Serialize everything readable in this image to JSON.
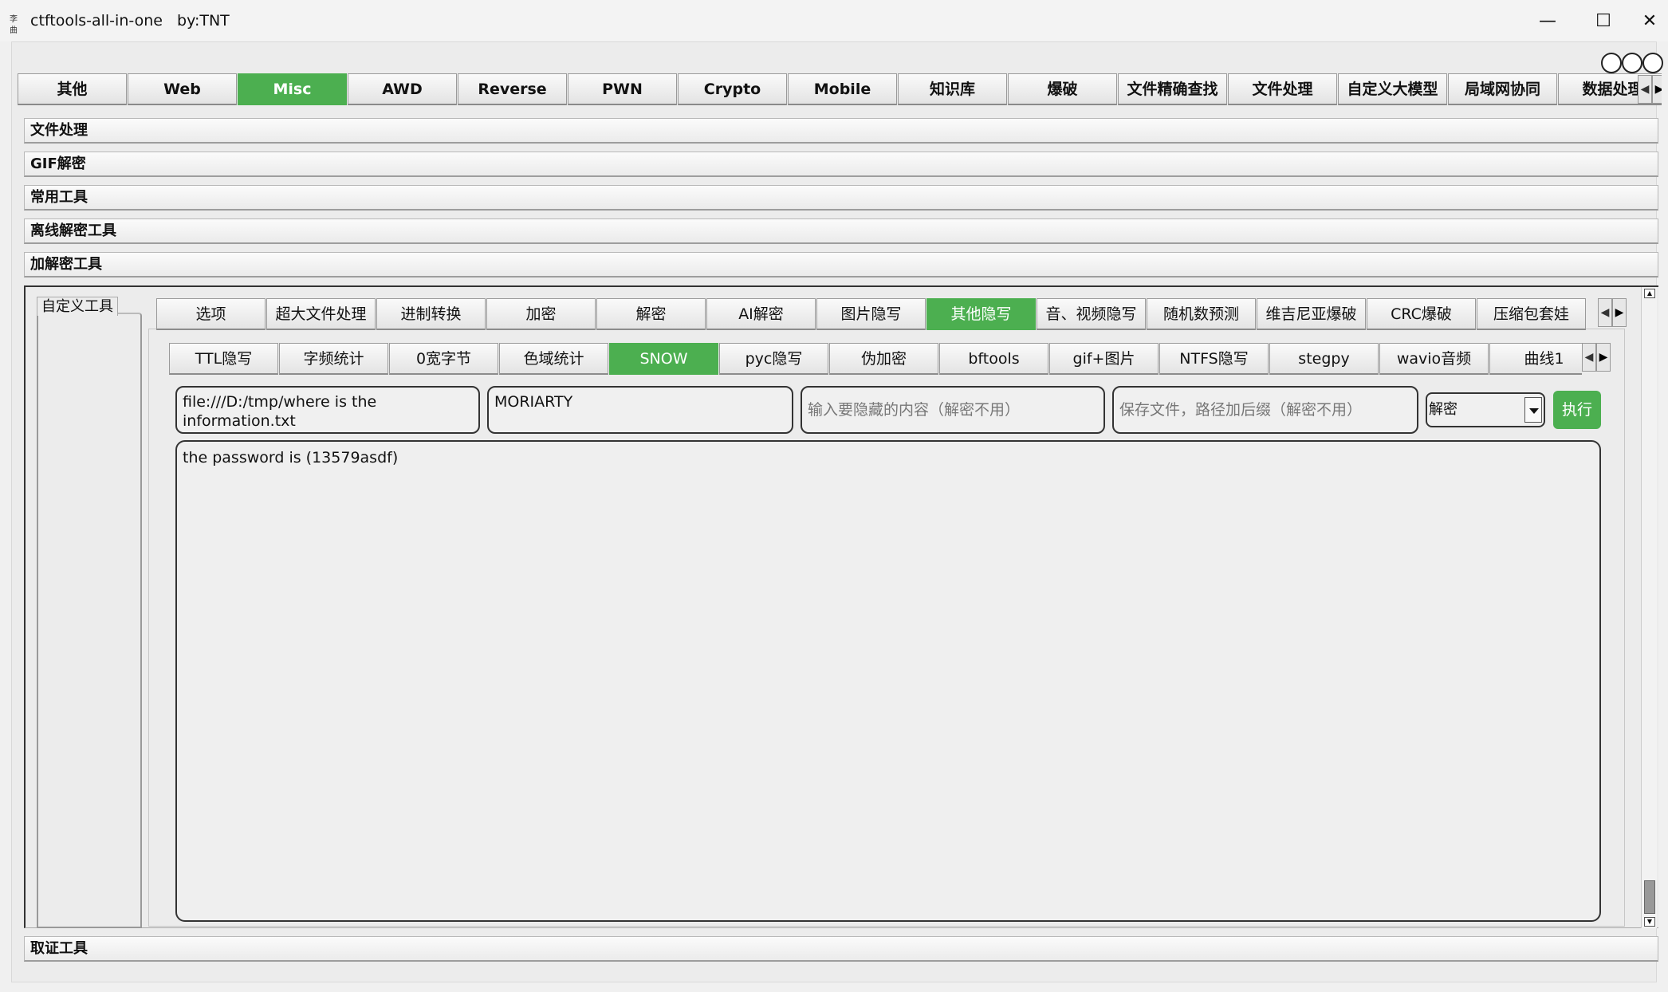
{
  "window": {
    "icon_text": "李曲",
    "title": "ctftools-all-in-one   by:TNT",
    "minimize": "—",
    "maximize": "☐",
    "close": "✕"
  },
  "main_tabs": [
    "其他",
    "Web",
    "Misc",
    "AWD",
    "Reverse",
    "PWN",
    "Crypto",
    "Mobile",
    "知识库",
    "爆破",
    "文件精确查找",
    "文件处理",
    "自定义大模型",
    "局域网协同",
    "数据处理"
  ],
  "main_tab_active": "Misc",
  "sections": {
    "file_processing": "文件处理",
    "gif_decrypt": "GIF解密",
    "common_tools": "常用工具",
    "offline_decrypt": "离线解密工具",
    "encrypt_decrypt": "加解密工具",
    "forensics": "取证工具"
  },
  "custom_tools_tab": "自定义工具",
  "sub_tabs": [
    "选项",
    "超大文件处理",
    "进制转换",
    "加密",
    "解密",
    "AI解密",
    "图片隐写",
    "其他隐写",
    "音、视频隐写",
    "随机数预测",
    "维吉尼亚爆破",
    "CRC爆破",
    "压缩包套娃"
  ],
  "sub_tab_active": "其他隐写",
  "steg_tabs": [
    "TTL隐写",
    "字频统计",
    "0宽字节",
    "色域统计",
    "SNOW",
    "pyc隐写",
    "伪加密",
    "bftools",
    "gif+图片",
    "NTFS隐写",
    "stegpy",
    "wavio音频",
    "曲线1"
  ],
  "steg_tab_active": "SNOW",
  "form": {
    "file_path": "file:///D:/tmp/where is the information.txt",
    "password": "MORIARTY",
    "hide_content_placeholder": "输入要隐藏的内容（解密不用）",
    "save_path_placeholder": "保存文件，路径加后缀（解密不用）",
    "mode": "解密",
    "execute": "执行"
  },
  "output": "the password is (13579asdf)",
  "colors": {
    "accent": "#4caf50"
  }
}
